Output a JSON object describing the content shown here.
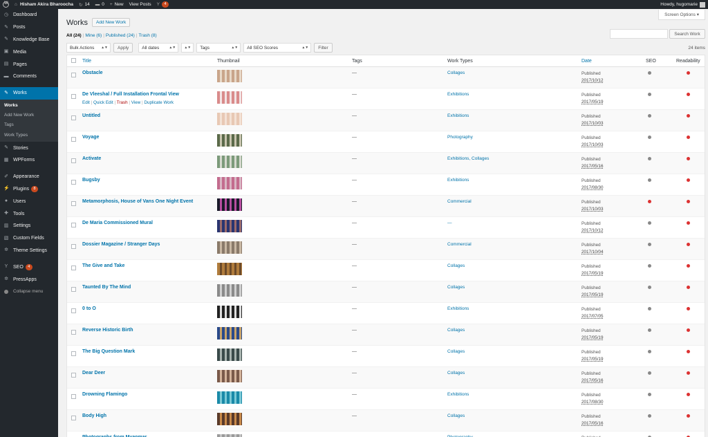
{
  "adminbar": {
    "site_name": "Hisham Akira Bharoocha",
    "updates": "14",
    "comments": "0",
    "new": "New",
    "view_posts": "View Posts",
    "notifications": "4",
    "howdy": "Howdy, hugomarie"
  },
  "sidebar": {
    "items": [
      {
        "label": "Dashboard",
        "icon": "dashboard-icon",
        "glyph": "◷"
      },
      {
        "label": "Posts",
        "icon": "pin-icon",
        "glyph": "✎"
      },
      {
        "label": "Knowledge Base",
        "icon": "pin-icon",
        "glyph": "✎"
      },
      {
        "label": "Media",
        "icon": "media-icon",
        "glyph": "▣"
      },
      {
        "label": "Pages",
        "icon": "pages-icon",
        "glyph": "▤"
      },
      {
        "label": "Comments",
        "icon": "comment-icon",
        "glyph": "▬"
      },
      {
        "label": "Works",
        "icon": "pin-icon",
        "glyph": "✎"
      },
      {
        "label": "Stories",
        "icon": "pin-icon",
        "glyph": "✎"
      },
      {
        "label": "WPForms",
        "icon": "form-icon",
        "glyph": "▦"
      },
      {
        "label": "Appearance",
        "icon": "brush-icon",
        "glyph": "✐"
      },
      {
        "label": "Plugins",
        "icon": "plugin-icon",
        "glyph": "⚡",
        "badge": "8"
      },
      {
        "label": "Users",
        "icon": "users-icon",
        "glyph": "●"
      },
      {
        "label": "Tools",
        "icon": "wrench-icon",
        "glyph": "✚"
      },
      {
        "label": "Settings",
        "icon": "settings-icon",
        "glyph": "▥"
      },
      {
        "label": "Custom Fields",
        "icon": "fields-icon",
        "glyph": "▧"
      },
      {
        "label": "Theme Settings",
        "icon": "gear-icon",
        "glyph": "✲"
      },
      {
        "label": "SEO",
        "icon": "seo-icon",
        "glyph": "Y",
        "badge": "4"
      },
      {
        "label": "PressApps",
        "icon": "gear-icon",
        "glyph": "✲"
      },
      {
        "label": "Collapse menu",
        "icon": "collapse-icon",
        "glyph": ""
      }
    ],
    "works_submenu": [
      "Works",
      "Add New Work",
      "Tags",
      "Work Types"
    ]
  },
  "page": {
    "screen_options": "Screen Options ▾",
    "title": "Works",
    "add_new": "Add New Work",
    "views": {
      "all": "All (24)",
      "mine": "Mine (6)",
      "published": "Published (24)",
      "trash": "Trash (8)"
    },
    "search_button": "Search Work",
    "bulk_actions": "Bulk Actions",
    "apply": "Apply",
    "all_dates": "All dates",
    "tags_filter": "Tags",
    "seo_filter": "All SEO Scores",
    "filter": "Filter",
    "items_count": "24 items"
  },
  "table": {
    "headers": {
      "title": "Title",
      "thumbnail": "Thumbnail",
      "tags": "Tags",
      "work_types": "Work Types",
      "date": "Date",
      "seo": "SEO",
      "readability": "Readability"
    },
    "row_actions": {
      "edit": "Edit",
      "quick_edit": "Quick Edit",
      "trash": "Trash",
      "view": "View",
      "duplicate": "Duplicate Work"
    },
    "colors": {
      "seo_gray": "#888888",
      "red": "#dc3232"
    },
    "rows": [
      {
        "title": "Obstacle",
        "tags": "—",
        "types": "Collages",
        "status": "Published",
        "date": "2017/10/12",
        "seo": "gray",
        "read": "red",
        "thumb": [
          "#c9a58a",
          "#e8d9c8"
        ]
      },
      {
        "title": "De Vleeshal / Full Installation Frontal View",
        "tags": "—",
        "types": "Exhibitions",
        "status": "Published",
        "date": "2017/05/19",
        "seo": "gray",
        "read": "red",
        "thumb": [
          "#d98b8b",
          "#f2e4e4"
        ],
        "hover": true
      },
      {
        "title": "Untitled",
        "tags": "—",
        "types": "Exhibitions",
        "status": "Published",
        "date": "2017/10/03",
        "seo": "gray",
        "read": "red",
        "thumb": [
          "#e8c8b4",
          "#f3e2d6"
        ]
      },
      {
        "title": "Voyage",
        "tags": "—",
        "types": "Photography",
        "status": "Published",
        "date": "2017/10/03",
        "seo": "gray",
        "read": "red",
        "thumb": [
          "#5b6a4a",
          "#c9c5b0"
        ]
      },
      {
        "title": "Activate",
        "tags": "—",
        "types": "Exhibitions, Collages",
        "status": "Published",
        "date": "2017/05/16",
        "seo": "gray",
        "read": "red",
        "thumb": [
          "#7c9a7a",
          "#d6d9cf"
        ]
      },
      {
        "title": "Bugsby",
        "tags": "—",
        "types": "Exhibitions",
        "status": "Published",
        "date": "2017/08/30",
        "seo": "gray",
        "read": "red",
        "thumb": [
          "#c36c8e",
          "#d9b7c4"
        ]
      },
      {
        "title": "Metamorphosis, House of Vans One Night Event",
        "tags": "—",
        "types": "Commercial",
        "status": "Published",
        "date": "2017/10/03",
        "seo": "red",
        "read": "red",
        "thumb": [
          "#1b1b2b",
          "#b84ea0"
        ]
      },
      {
        "title": "De Maria Commissioned Mural",
        "tags": "—",
        "types": "—",
        "status": "Published",
        "date": "2017/10/12",
        "seo": "gray",
        "read": "red",
        "thumb": [
          "#2a3570",
          "#9b6b6b"
        ]
      },
      {
        "title": "Dossier Magazine / Stranger Days",
        "tags": "—",
        "types": "Commercial",
        "status": "Published",
        "date": "2017/10/04",
        "seo": "gray",
        "read": "red",
        "thumb": [
          "#8a7a6a",
          "#c9b8a4"
        ]
      },
      {
        "title": "The Give and Take",
        "tags": "—",
        "types": "Collages",
        "status": "Published",
        "date": "2017/05/19",
        "seo": "gray",
        "read": "red",
        "thumb": [
          "#b07c3c",
          "#6b4a2a"
        ]
      },
      {
        "title": "Taunted By The Mind",
        "tags": "—",
        "types": "Collages",
        "status": "Published",
        "date": "2017/05/19",
        "seo": "gray",
        "read": "red",
        "thumb": [
          "#8a8a8a",
          "#d0d0d0"
        ]
      },
      {
        "title": "0 to O",
        "tags": "—",
        "types": "Exhibitions",
        "status": "Published",
        "date": "2017/07/05",
        "seo": "gray",
        "read": "red",
        "thumb": [
          "#222222",
          "#dddddd"
        ]
      },
      {
        "title": "Reverse Historic Birth",
        "tags": "—",
        "types": "Collages",
        "status": "Published",
        "date": "2017/05/19",
        "seo": "gray",
        "read": "red",
        "thumb": [
          "#2a4a8a",
          "#c9a46a"
        ]
      },
      {
        "title": "The Big Question Mark",
        "tags": "—",
        "types": "Collages",
        "status": "Published",
        "date": "2017/05/19",
        "seo": "gray",
        "read": "red",
        "thumb": [
          "#3a4a4a",
          "#a9b4b0"
        ]
      },
      {
        "title": "Dear Deer",
        "tags": "—",
        "types": "Collages",
        "status": "Published",
        "date": "2017/05/16",
        "seo": "gray",
        "read": "red",
        "thumb": [
          "#7a5a4a",
          "#d4b49c"
        ]
      },
      {
        "title": "Drowning Flamingo",
        "tags": "—",
        "types": "Exhibitions",
        "status": "Published",
        "date": "2017/08/30",
        "seo": "gray",
        "read": "red",
        "thumb": [
          "#1a8aa8",
          "#7cc9d6"
        ]
      },
      {
        "title": "Body High",
        "tags": "—",
        "types": "Collages",
        "status": "Published",
        "date": "2017/05/16",
        "seo": "gray",
        "read": "red",
        "thumb": [
          "#5a3a2a",
          "#c98a4a"
        ]
      },
      {
        "title": "Photographs from Myanmar",
        "tags": "—",
        "types": "Photography",
        "status": "Published",
        "date": "",
        "seo": "gray",
        "read": "red",
        "thumb": [
          "#9a9a9a",
          "#c4c4c4"
        ]
      }
    ]
  }
}
